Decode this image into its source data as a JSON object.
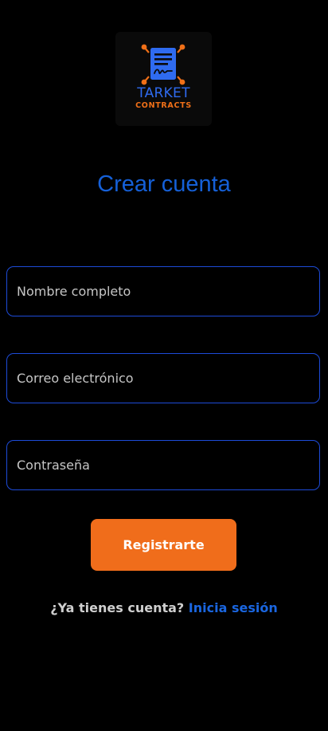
{
  "logo": {
    "name": "TARKET",
    "subtitle": "CONTRACTS",
    "icon": "contract-document-icon"
  },
  "title": "Crear cuenta",
  "form": {
    "full_name": {
      "placeholder": "Nombre completo",
      "value": ""
    },
    "email": {
      "placeholder": "Correo electrónico",
      "value": ""
    },
    "password": {
      "placeholder": "Contraseña",
      "value": ""
    }
  },
  "register_button": {
    "label": "Registrarte"
  },
  "login_prompt": {
    "text": "¿Ya tienes cuenta?",
    "link_label": "Inicia sesión"
  },
  "colors": {
    "background": "#000000",
    "primary_blue": "#1560d8",
    "accent_orange": "#f06d1b",
    "field_border": "#1d4bd8"
  }
}
